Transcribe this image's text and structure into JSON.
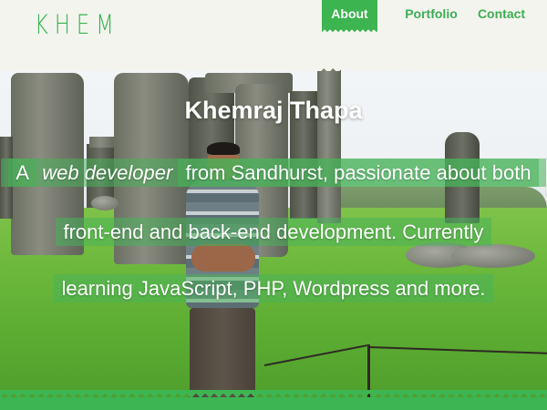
{
  "header": {
    "logo_text": "KHEM",
    "nav": [
      {
        "label": "About",
        "active": true
      },
      {
        "label": "Portfolio",
        "active": false
      },
      {
        "label": "Contact",
        "active": false
      }
    ]
  },
  "hero": {
    "name": "Khemraj Thapa",
    "tagline_prefix": "A",
    "tagline_emphasis": "web developer",
    "tagline_line1_rest": "from Sandhurst, passionate about both",
    "tagline_line2": "front-end and back-end development. Currently",
    "tagline_line3": "learning JavaScript, PHP, Wordpress and more."
  },
  "colors": {
    "accent": "#3cb44f",
    "header_bg": "#f3f4ee",
    "tagline_highlight": "rgba(72,178,90,0.55)"
  }
}
